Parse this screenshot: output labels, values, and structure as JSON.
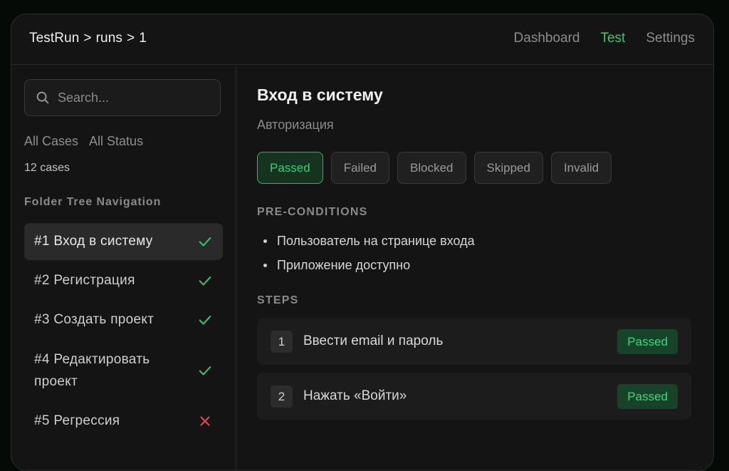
{
  "header": {
    "breadcrumb": [
      "TestRun",
      "runs",
      "1"
    ],
    "breadcrumb_sep": ">",
    "nav": [
      {
        "label": "Dashboard",
        "active": false
      },
      {
        "label": "Test",
        "active": true
      },
      {
        "label": "Settings",
        "active": false
      }
    ]
  },
  "sidebar": {
    "search_placeholder": "Search...",
    "filters": [
      "All Cases",
      "All Status"
    ],
    "count": "12 cases",
    "section_title": "Folder Tree Navigation",
    "items": [
      {
        "label": "#1 Вход в систему",
        "status": "check-icon",
        "selected": true
      },
      {
        "label": "#2 Регистрация",
        "status": "check-icon",
        "selected": false
      },
      {
        "label": "#3 Создать проект",
        "status": "check-icon",
        "selected": false
      },
      {
        "label": "#4 Редактировать проект",
        "status": "check-icon",
        "selected": false
      },
      {
        "label": "#5 Регрессия",
        "status": "cross-icon",
        "selected": false
      }
    ]
  },
  "main": {
    "title": "Вход в систему",
    "subtitle": "Авторизация",
    "statuses": [
      {
        "label": "Passed",
        "active": true
      },
      {
        "label": "Failed",
        "active": false
      },
      {
        "label": "Blocked",
        "active": false
      },
      {
        "label": "Skipped",
        "active": false
      },
      {
        "label": "Invalid",
        "active": false
      }
    ],
    "preconditions_title": "PRE-CONDITIONS",
    "preconditions": [
      "Пользователь на странице входа",
      "Приложение доступно"
    ],
    "steps_title": "STEPS",
    "steps": [
      {
        "num": "1",
        "text": "Ввести email и пароль",
        "status": "Passed"
      },
      {
        "num": "2",
        "text": "Нажать «Войти»",
        "status": "Passed"
      }
    ]
  },
  "colors": {
    "accent_green": "#2fcf6b",
    "fail_red": "#e5484d",
    "background": "#141414"
  }
}
